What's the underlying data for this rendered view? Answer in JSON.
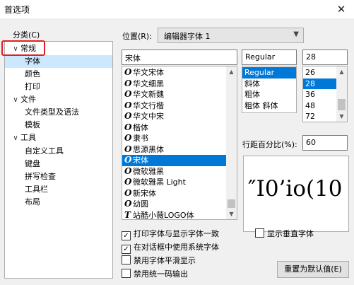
{
  "window": {
    "title": "首选项",
    "close_glyph": "✕"
  },
  "categories": {
    "label": "分类(C)",
    "items": [
      {
        "label": "常规",
        "chevron": "∨"
      },
      {
        "label": "字体",
        "chevron": ""
      },
      {
        "label": "颜色",
        "chevron": ""
      },
      {
        "label": "打印",
        "chevron": ""
      },
      {
        "label": "文件",
        "chevron": "∨"
      },
      {
        "label": "文件类型及语法",
        "chevron": ""
      },
      {
        "label": "模板",
        "chevron": ""
      },
      {
        "label": "工具",
        "chevron": "∨"
      },
      {
        "label": "自定义工具",
        "chevron": ""
      },
      {
        "label": "键盘",
        "chevron": ""
      },
      {
        "label": "拼写检查",
        "chevron": ""
      },
      {
        "label": "工具栏",
        "chevron": ""
      },
      {
        "label": "布局",
        "chevron": ""
      }
    ],
    "selected": "字体"
  },
  "position": {
    "label": "位置(R):",
    "value": "编辑器字体 1"
  },
  "font": {
    "value": "宋体",
    "list": [
      {
        "name": "华文宋体",
        "icon": "O"
      },
      {
        "name": "华文细黑",
        "icon": "O"
      },
      {
        "name": "华文新魏",
        "icon": "O"
      },
      {
        "name": "华文行楷",
        "icon": "O"
      },
      {
        "name": "华文中宋",
        "icon": "O"
      },
      {
        "name": "楷体",
        "icon": "O"
      },
      {
        "name": "隶书",
        "icon": "O"
      },
      {
        "name": "思源黑体",
        "icon": "O"
      },
      {
        "name": "宋体",
        "icon": "O"
      },
      {
        "name": "微软雅黑",
        "icon": "O"
      },
      {
        "name": "微软雅黑 Light",
        "icon": "O"
      },
      {
        "name": "新宋体",
        "icon": "O"
      },
      {
        "name": "幼圆",
        "icon": "O"
      },
      {
        "name": "站酷小薇LOGO体",
        "icon": "T"
      }
    ],
    "selected": "宋体"
  },
  "style": {
    "value": "Regular",
    "list": [
      "Regular",
      "斜体",
      "粗体",
      "粗体 斜体"
    ],
    "selected": "Regular"
  },
  "size": {
    "value": "28",
    "list": [
      "26",
      "28",
      "36",
      "48",
      "72"
    ],
    "selected": "28"
  },
  "line_spacing": {
    "label": "行距百分比(%):",
    "value": "60"
  },
  "preview": {
    "text": "″I0’io(10"
  },
  "options": [
    {
      "label": "打印字体与显示字体一致",
      "checked": true
    },
    {
      "label": "在对话框中使用系统字体",
      "checked": true
    },
    {
      "label": "禁用字体平滑显示",
      "checked": false
    },
    {
      "label": "禁用统一码输出",
      "checked": false
    }
  ],
  "vertical_font": {
    "label": "显示垂直字体",
    "checked": false
  },
  "reset_button": {
    "label": "重置为默认值(E)"
  },
  "scroll_glyphs": {
    "up": "▲",
    "down": "▼"
  }
}
